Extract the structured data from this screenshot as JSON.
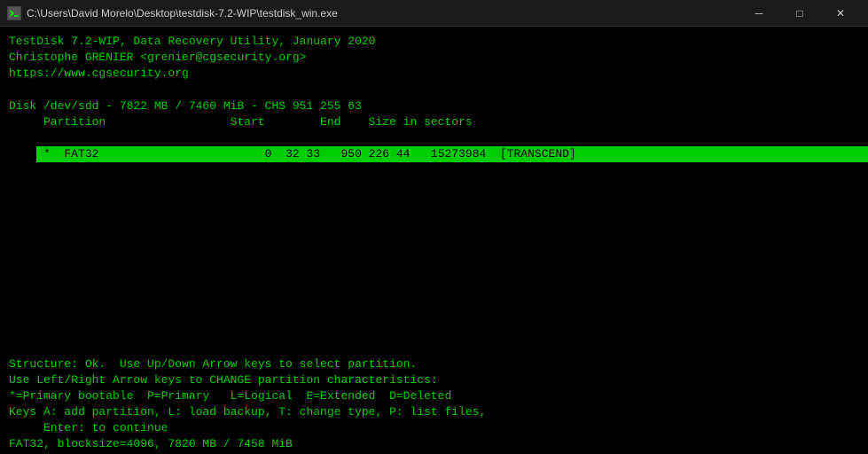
{
  "titlebar": {
    "icon": "terminal-icon",
    "title": "C:\\Users\\David Morelo\\Desktop\\testdisk-7.2-WIP\\testdisk_win.exe",
    "minimize_label": "─",
    "maximize_label": "□",
    "close_label": "✕"
  },
  "terminal": {
    "line1": "TestDisk 7.2-WIP, Data Recovery Utility, January 2020",
    "line2": "Christophe GRENIER <grenier@cgsecurity.org>",
    "line3": "https://www.cgsecurity.org",
    "line4": "",
    "line5": "Disk /dev/sdd - 7822 MB / 7460 MiB - CHS 951 255 63",
    "line6": "     Partition                  Start        End    Size in sectors",
    "partition_row": " *  FAT32                        0  32 33   950 226 44   15273984  [TRANSCEND]",
    "status1": "Structure: Ok.  Use Up/Down Arrow keys to select partition.",
    "status2": "Use Left/Right Arrow keys to CHANGE partition characteristics:",
    "status3": "*=Primary bootable  P=Primary   L=Logical  E=Extended  D=Deleted",
    "status4": "Keys A: add partition, L: load backup, T: change type, P: list files,",
    "status5": "     Enter: to continue",
    "bottombar": "FAT32, blocksize=4096, 7820 MB / 7458 MiB"
  }
}
